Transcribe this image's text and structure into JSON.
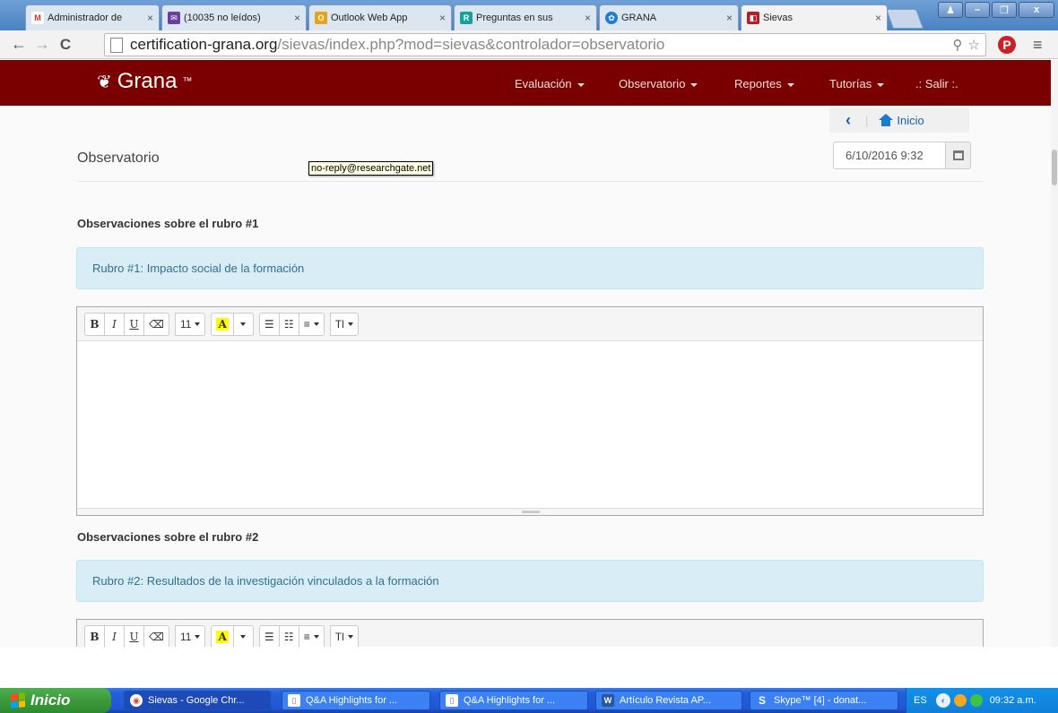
{
  "browser": {
    "tabs": [
      {
        "label": "Administrador de",
        "icon": "gmail-icon",
        "color": "#d93025"
      },
      {
        "label": "(10035 no leídos)",
        "icon": "mail-icon",
        "color": "#6b3fa0"
      },
      {
        "label": "Outlook Web App",
        "icon": "outlook-icon",
        "color": "#e8a317"
      },
      {
        "label": "Preguntas en sus",
        "icon": "researchgate-icon",
        "color": "#14a39a"
      },
      {
        "label": "GRANA",
        "icon": "grana-icon",
        "color": "#1c7ed6"
      },
      {
        "label": "Sievas",
        "icon": "sievas-icon",
        "color": "#b21f24"
      }
    ],
    "url_host": "certification-grana.org",
    "url_path": "/sievas/index.php?mod=sievas&controlador=observatorio"
  },
  "site": {
    "brand": "Grana",
    "brand_mark": "™",
    "nav": [
      "Evaluación",
      "Observatorio",
      "Reportes",
      "Tutorías"
    ],
    "logout": ".: Salir :.",
    "home_link": "Inicio",
    "page_title": "Observatorio",
    "date_value": "6/10/2016 9:32",
    "tooltip": "no-reply@researchgate.net",
    "brand_color": "#7a0000",
    "sections": [
      {
        "heading": "Observaciones sobre el rubro #1",
        "rubro": "Rubro #1: Impacto social de la formación"
      },
      {
        "heading": "Observaciones sobre el rubro #2",
        "rubro": "Rubro #2: Resultados de la investigación vinculados a la formación"
      }
    ],
    "editor_toolbar": {
      "bold": "B",
      "italic": "I",
      "underline": "U",
      "font_size": "11",
      "color_letter": "A",
      "style": "Tl"
    }
  },
  "taskbar": {
    "start": "Inicio",
    "tasks": [
      "Sievas - Google Chr...",
      "Q&A Highlights for ...",
      "Q&A Highlights for ...",
      "Artículo Revista AP...",
      "Skype™ [4] - donat..."
    ],
    "lang": "ES",
    "clock": "09:32 a.m."
  }
}
